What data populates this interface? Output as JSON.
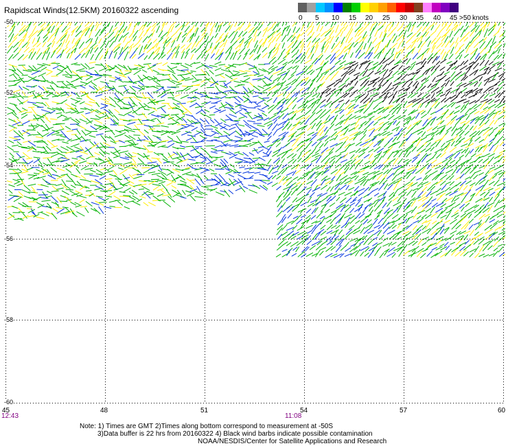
{
  "title": "Rapidscat Winds(12.5KM) 20160322 ascending",
  "color_scale": {
    "swatches": [
      "#606060",
      "#a0a0a0",
      "#00c8ff",
      "#0090ff",
      "#0000ff",
      "#008000",
      "#00d000",
      "#ffff00",
      "#ffd000",
      "#ffa000",
      "#ff6000",
      "#ff0000",
      "#c00000",
      "#804020",
      "#ff80ff",
      "#c000c0",
      "#8000c0",
      "#400080"
    ],
    "labels": [
      "0",
      "5",
      "10",
      "15",
      "20",
      "25",
      "30",
      "35",
      "40",
      "45",
      ">50"
    ],
    "unit": "knots"
  },
  "map": {
    "lon_ticks": [
      "45",
      "48",
      "51",
      "54",
      "57",
      "60"
    ],
    "lat_ticks": [
      "-50",
      "-52",
      "-54",
      "-56",
      "-58",
      "-60"
    ],
    "time_labels": [
      "12:43",
      "11:08"
    ],
    "barb_colors": {
      "fast": "#ffee00",
      "medium": "#00b000",
      "slow": "#0033dd",
      "contaminated": "#000000"
    }
  },
  "notes": [
    "Note: 1) Times are GMT 2)Times along bottom correspond to measurement at -50S",
    "3)Data buffer is 22 hrs from 20160322 4) Black wind barbs indicate possible contamination",
    "NOAA/NESDIS/Center for Satellite Applications and Research"
  ]
}
